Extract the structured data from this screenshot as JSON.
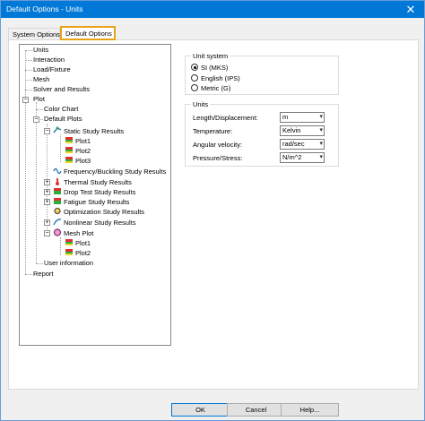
{
  "window": {
    "title": "Default Options - Units",
    "close_glyph": "✕"
  },
  "tabs": [
    {
      "label": "System Options"
    },
    {
      "label": "Default Options"
    }
  ],
  "tree": {
    "units": "Units",
    "interaction": "Interaction",
    "load_fixture": "Load/Fixture",
    "mesh": "Mesh",
    "solver": "Solver and Results",
    "plot": "Plot",
    "color_chart": "Color Chart",
    "default_plots": "Default Plots",
    "static": "Static Study Results",
    "static_plots": [
      "Plot1",
      "Plot2",
      "Plot3"
    ],
    "frequency": "Frequency/Buckling Study Results",
    "thermal": "Thermal Study Results",
    "drop": "Drop Test Study Results",
    "fatigue": "Fatigue Study Results",
    "optimization": "Optimization Study Results",
    "nonlinear": "Nonlinear Study Results",
    "mesh_plot": "Mesh Plot",
    "mesh_plots": [
      "Plot1",
      "Plot2"
    ],
    "user_info": "User information",
    "report": "Report"
  },
  "unit_system": {
    "legend": "Unit system",
    "options": [
      "SI (MKS)",
      "English (IPS)",
      "Metric (G)"
    ],
    "selected_index": 0
  },
  "units": {
    "legend": "Units",
    "rows": [
      {
        "label": "Length/Displacement:",
        "value": "m"
      },
      {
        "label": "Temperature:",
        "value": "Kelvin"
      },
      {
        "label": "Angular velocity:",
        "value": "rad/sec"
      },
      {
        "label": "Pressure/Stress:",
        "value": "N/m^2"
      }
    ]
  },
  "buttons": {
    "ok": "OK",
    "cancel": "Cancel",
    "help": "Help..."
  },
  "colors": {
    "titlebar": "#0078d7",
    "tab_highlight": "#e8a317"
  }
}
